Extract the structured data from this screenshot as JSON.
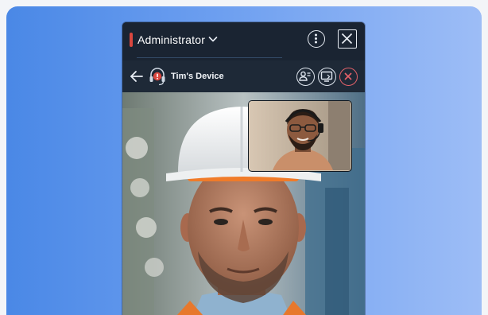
{
  "window": {
    "role_label": "Administrator",
    "role_accent_color": "#d9473f",
    "role_dropdown_icon": "chevron-down-icon",
    "menu_icon": "more-vertical-icon",
    "close_icon": "close-icon"
  },
  "device_bar": {
    "back_icon": "arrow-left-icon",
    "device_icon": "headset-alert-icon",
    "device_name": "Tim's Device",
    "actions": [
      {
        "icon": "participants-icon"
      },
      {
        "icon": "screen-share-icon"
      },
      {
        "icon": "end-call-icon",
        "color": "#e26169"
      }
    ]
  },
  "video": {
    "main_feed": "remote-participant-video",
    "self_view": "local-participant-video"
  },
  "colors": {
    "background_gradient_start": "#4a88e6",
    "background_gradient_end": "#9dbdf6",
    "panel": "#1a2432"
  }
}
